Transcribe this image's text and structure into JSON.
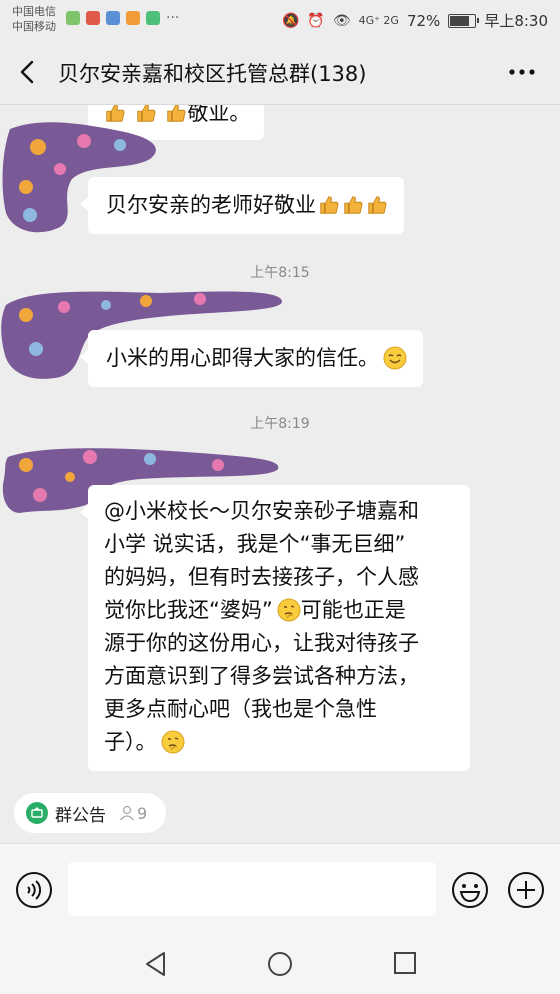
{
  "status_bar": {
    "carrier1": "中国电信",
    "carrier2": "中国移动",
    "network": "4G⁺ 2G",
    "battery": "72%",
    "battery_level": 0.72,
    "time": "早上8:30"
  },
  "header": {
    "title": "贝尔安亲嘉和校区托管总群(138)"
  },
  "messages": [
    {
      "text": "敬业。"
    },
    {
      "text": "贝尔安亲的老师好敬业"
    },
    {
      "timestamp": "上午8:15"
    },
    {
      "text": "小米的用心即得大家的信任。"
    },
    {
      "timestamp": "上午8:19"
    },
    {
      "lines": [
        "@小米校长～贝尔安亲砂子塘嘉和",
        "小学  说实话，我是个“事无巨细”",
        "的妈妈，但有时去接孩子，个人感",
        "觉你比我还“婆妈”",
        "可能也正是",
        "源于你的这份用心，让我对待孩子",
        "方面意识到了得多尝试各种方法，",
        "更多点耐心吧（我也是个急性",
        "子）。"
      ]
    }
  ],
  "group_notice": {
    "label": "群公告",
    "count": "9"
  },
  "input": {
    "placeholder": ""
  },
  "colors": {
    "background": "#ededed",
    "bubble": "#ffffff",
    "notice_green": "#2aae67",
    "avatar_purple": "#7a5a96"
  }
}
